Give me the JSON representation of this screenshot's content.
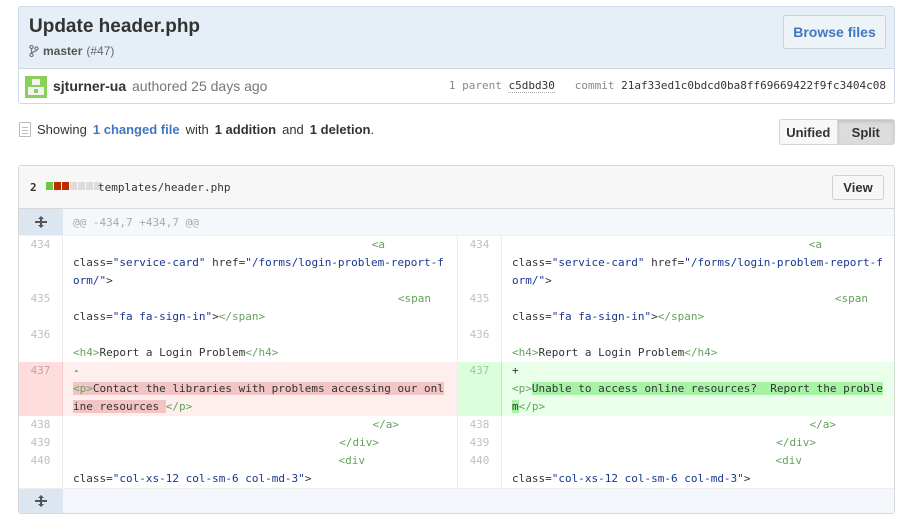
{
  "commit": {
    "title": "Update header.php",
    "branch": "master",
    "pr": "(#47)",
    "browse_label": "Browse files",
    "author": "sjturner-ua",
    "authored_text": "authored 25 days ago",
    "parent_label": "1 parent",
    "parent_sha": "c5dbd30",
    "commit_label": "commit",
    "commit_sha": "21af33ed1c0bdcd0ba8ff69669422f9fc3404c08"
  },
  "toc": {
    "showing": "Showing",
    "changed_link": "1 changed file",
    "with": "with",
    "additions": "1 addition",
    "and": "and",
    "deletions": "1 deletion",
    "period": "."
  },
  "view_toggle": {
    "unified": "Unified",
    "split": "Split",
    "selected": "Split"
  },
  "file": {
    "changes": "2",
    "path": "templates/header.php",
    "view_label": "View",
    "hunk_header": "@@ -434,7 +434,7 @@",
    "diffstat_colors": [
      "#6cc644",
      "#bd2c00",
      "#bd2c00",
      "#dddddd",
      "#dddddd",
      "#dddddd",
      "#dddddd"
    ]
  },
  "lines": {
    "n434": "434",
    "n435": "435",
    "n436": "436",
    "n437": "437",
    "n438": "438",
    "n439": "439",
    "n440": "440",
    "del_marker": "-",
    "add_marker": "+",
    "del_text": "Contact the libraries with problems accessing our online resources ",
    "add_text": "Unable to access online resources?  Report the problem",
    "h4_text": "Report a Login Problem"
  },
  "colors": {
    "deletion_bg": "#ffeeee",
    "addition_bg": "#eaffea",
    "link": "#4078c0",
    "header_bg": "#e6eff7"
  }
}
